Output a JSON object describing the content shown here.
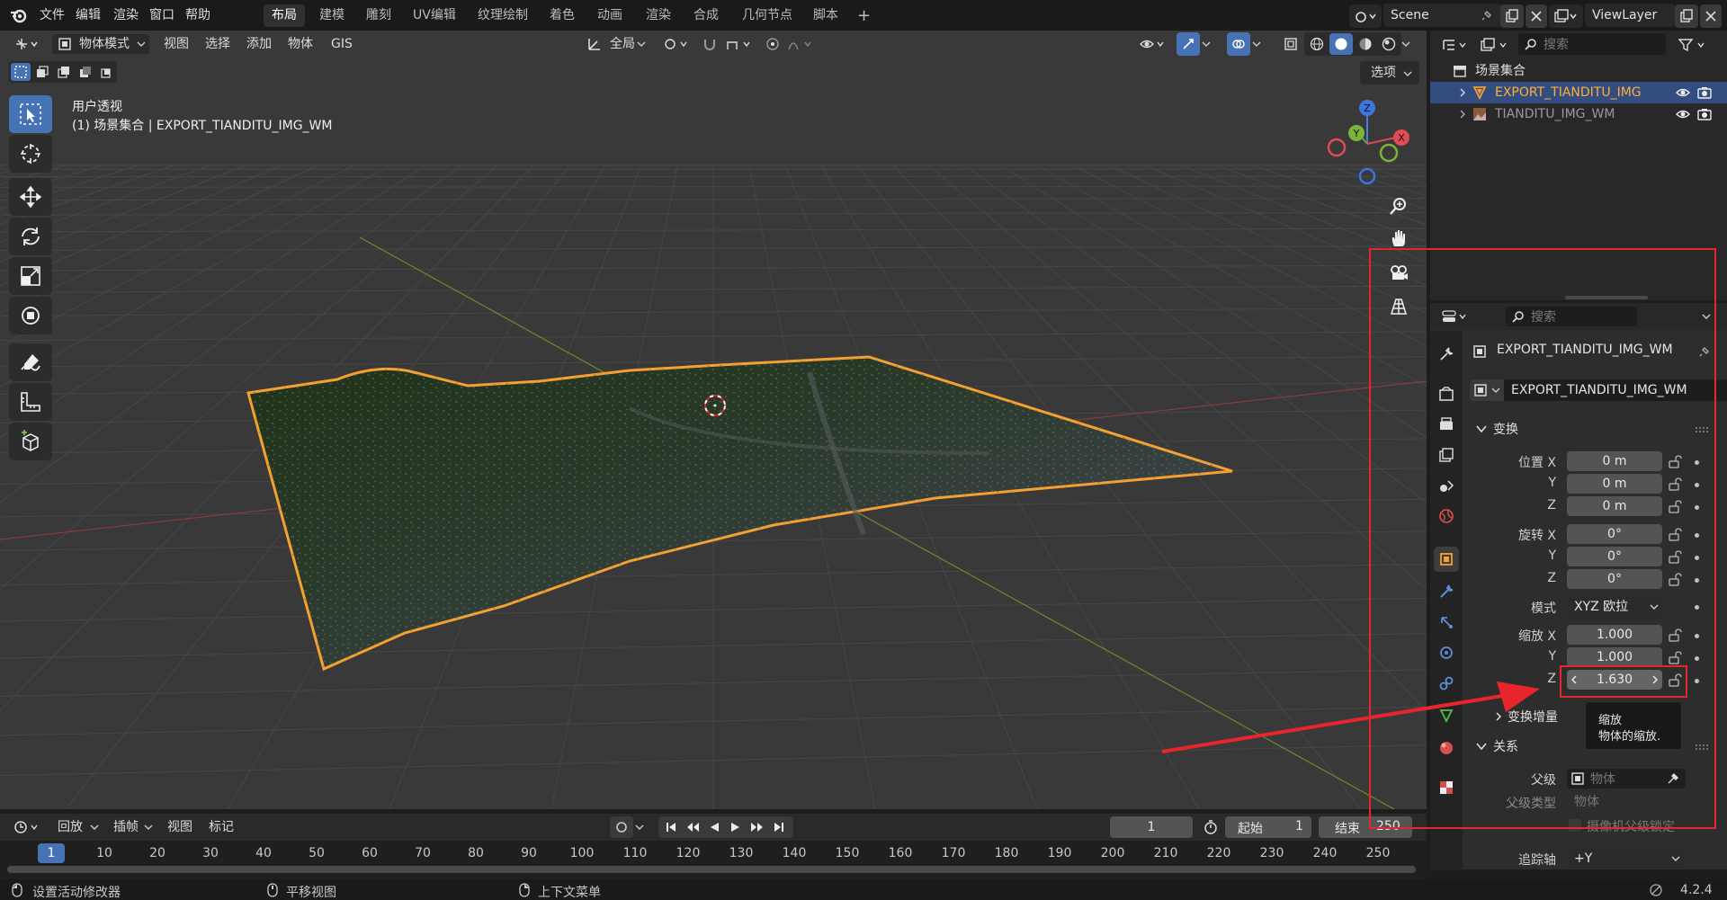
{
  "menubar": {
    "items": [
      "文件",
      "编辑",
      "渲染",
      "窗口",
      "帮助"
    ],
    "workspaces": [
      "布局",
      "建模",
      "雕刻",
      "UV编辑",
      "纹理绘制",
      "着色",
      "动画",
      "渲染",
      "合成",
      "几何节点",
      "脚本"
    ],
    "active_workspace": "布局",
    "add_tab": "+",
    "scene": "Scene",
    "view_layer": "ViewLayer"
  },
  "viewport_header": {
    "mode": "物体模式",
    "menus": [
      "视图",
      "选择",
      "添加",
      "物体",
      "GIS"
    ],
    "orientation": "全局",
    "options": "选项"
  },
  "viewport": {
    "view_name": "用户透视",
    "object_info": "(1) 场景集合 | EXPORT_TIANDITU_IMG_WM",
    "gizmo": {
      "x": "X",
      "y": "Y",
      "z": "Z"
    }
  },
  "outliner": {
    "search_placeholder": "搜索",
    "root": "场景集合",
    "items": [
      {
        "name": "EXPORT_TIANDITU_IMG",
        "selected": true
      },
      {
        "name": "TIANDITU_IMG_WM",
        "selected": false
      }
    ]
  },
  "properties": {
    "search_placeholder": "搜索",
    "object_name": "EXPORT_TIANDITU_IMG_WM",
    "mesh_name": "EXPORT_TIANDITU_IMG_WM",
    "transform_title": "变换",
    "location_label": "位置 X",
    "y_label": "Y",
    "z_label": "Z",
    "location": [
      "0 m",
      "0 m",
      "0 m"
    ],
    "rotation_label": "旋转 X",
    "rotation": [
      "0°",
      "0°",
      "0°"
    ],
    "mode_label": "模式",
    "rotation_mode": "XYZ 欧拉",
    "scale_label": "缩放 X",
    "scale": [
      "1.000",
      "1.000",
      "1.630"
    ],
    "delta_title": "变换增量",
    "relations_title": "关系",
    "parent_label": "父级",
    "parent_placeholder": "物体",
    "parent_type_label": "父级类型",
    "parent_type_value": "物体",
    "camera_parent_lock": "摄像机父级锁定",
    "track_axis_label": "追踪轴",
    "track_axis_value": "+Y",
    "tooltip_title": "缩放",
    "tooltip_text": "物体的缩放."
  },
  "timeline": {
    "menus": [
      "回放",
      "插帧",
      "视图",
      "标记"
    ],
    "current_frame": "1",
    "start_label": "起始",
    "start": "1",
    "end_label": "结束",
    "end": "250",
    "ticks": [
      "1",
      "10",
      "20",
      "30",
      "40",
      "50",
      "60",
      "70",
      "80",
      "90",
      "100",
      "110",
      "120",
      "130",
      "140",
      "150",
      "160",
      "170",
      "180",
      "190",
      "200",
      "210",
      "220",
      "230",
      "240",
      "250"
    ]
  },
  "statusbar": {
    "left": "设置活动修改器",
    "middle": "平移视图",
    "right": "上下文菜单",
    "version": "4.2.4"
  },
  "colors": {
    "accent": "#4772b3",
    "selection_outline": "#f5a030",
    "annotation_red": "#e8252d"
  }
}
